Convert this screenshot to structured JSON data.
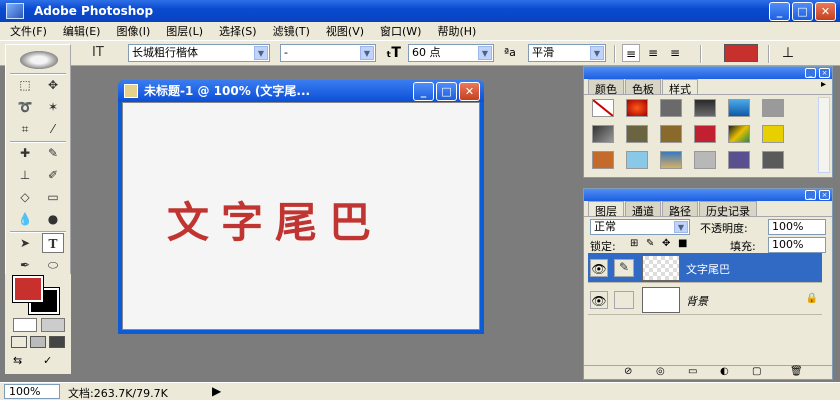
{
  "app": {
    "title": "Adobe Photoshop"
  },
  "window_buttons": {
    "minimize": "_",
    "maximize": "□",
    "close": "✕"
  },
  "menu": [
    "文件(F)",
    "编辑(E)",
    "图像(I)",
    "图层(L)",
    "选择(S)",
    "滤镜(T)",
    "视图(V)",
    "窗口(W)",
    "帮助(H)"
  ],
  "options": {
    "font_family": "长城粗行楷体",
    "font_style": "-",
    "font_size": "60 点",
    "antialias": "平滑",
    "text_color": "#c8302e"
  },
  "document": {
    "title": "未标题-1 @ 100% (文字尾...",
    "text": "文字尾巴",
    "text_color": "#c03531"
  },
  "colors": {
    "foreground": "#c8302e",
    "background": "#000000"
  },
  "styles_panel": {
    "tabs": [
      "颜色",
      "色板",
      "样式"
    ],
    "active_tab": "样式"
  },
  "layers_panel": {
    "tabs": [
      "图层",
      "通道",
      "路径",
      "历史记录"
    ],
    "active_tab": "图层",
    "blend_mode": "正常",
    "opacity_label": "不透明度:",
    "opacity": "100%",
    "lock_label": "锁定:",
    "fill_label": "填充:",
    "fill": "100%",
    "layers": [
      {
        "name": "文字尾巴",
        "selected": true
      },
      {
        "name": "背景",
        "selected": false
      }
    ]
  },
  "status": {
    "zoom": "100%",
    "doc_size": "文档:263.7K/79.7K"
  }
}
